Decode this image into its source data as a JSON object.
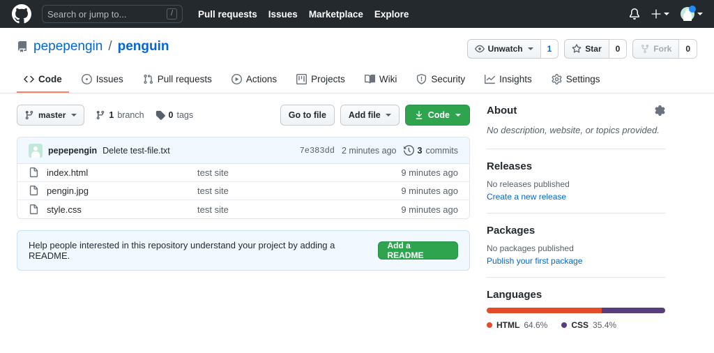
{
  "header": {
    "logo_icon": "github-mark-icon",
    "search": {
      "placeholder": "Search or jump to...",
      "value": "",
      "shortcut": "/"
    },
    "nav": [
      {
        "label": "Pull requests"
      },
      {
        "label": "Issues"
      },
      {
        "label": "Marketplace"
      },
      {
        "label": "Explore"
      }
    ],
    "notifications_icon": "bell-icon",
    "create_new_icon": "plus-icon",
    "avatar_icon": "user-avatar"
  },
  "repo": {
    "icon": "repo-icon",
    "owner": "pepepengin",
    "separator": "/",
    "name": "penguin",
    "actions": [
      {
        "name": "watch",
        "icon": "eye-icon",
        "label": "Unwatch",
        "count": "1",
        "has_caret": true,
        "muted": false
      },
      {
        "name": "star",
        "icon": "star-icon",
        "label": "Star",
        "count": "0",
        "has_caret": false,
        "muted": false
      },
      {
        "name": "fork",
        "icon": "fork-icon",
        "label": "Fork",
        "count": "0",
        "has_caret": false,
        "muted": true
      }
    ],
    "tabs": [
      {
        "label": "Code",
        "icon": "code-icon",
        "active": true
      },
      {
        "label": "Issues",
        "icon": "issue-opened-icon",
        "active": false
      },
      {
        "label": "Pull requests",
        "icon": "git-pull-request-icon",
        "active": false
      },
      {
        "label": "Actions",
        "icon": "play-icon",
        "active": false
      },
      {
        "label": "Projects",
        "icon": "project-board-icon",
        "active": false
      },
      {
        "label": "Wiki",
        "icon": "book-icon",
        "active": false
      },
      {
        "label": "Security",
        "icon": "shield-icon",
        "active": false
      },
      {
        "label": "Insights",
        "icon": "graph-icon",
        "active": false
      },
      {
        "label": "Settings",
        "icon": "gear-icon",
        "active": false
      }
    ]
  },
  "toolbar": {
    "branch_label": "master",
    "branch_icon": "git-branch-icon",
    "branches_count": "1",
    "branches_word": "branch",
    "tags_count": "0",
    "tags_word": "tags",
    "tag_icon": "tag-icon",
    "go_to_file_label": "Go to file",
    "add_file_label": "Add file",
    "code_label": "Code",
    "code_icon": "download-icon"
  },
  "commit": {
    "author": "pepepengin",
    "message": "Delete test-file.txt",
    "sha": "7e383dd",
    "time": "2 minutes ago",
    "commits_count": "3",
    "commits_word": "commits",
    "history_icon": "history-icon"
  },
  "files": {
    "icon": "file-icon",
    "rows": [
      {
        "name": "index.html",
        "message": "test site",
        "time": "9 minutes ago"
      },
      {
        "name": "pengin.jpg",
        "message": "test site",
        "time": "9 minutes ago"
      },
      {
        "name": "style.css",
        "message": "test site",
        "time": "9 minutes ago"
      }
    ]
  },
  "readme_banner": {
    "text": "Help people interested in this repository understand your project by adding a README.",
    "button_label": "Add a README"
  },
  "sidebar": {
    "about": {
      "title": "About",
      "gear_icon": "gear-icon",
      "description": "No description, website, or topics provided."
    },
    "releases": {
      "title": "Releases",
      "empty_text": "No releases published",
      "link_text": "Create a new release"
    },
    "packages": {
      "title": "Packages",
      "empty_text": "No packages published",
      "link_text": "Publish your first package"
    },
    "languages": {
      "title": "Languages",
      "items": [
        {
          "name": "HTML",
          "percent": "64.6%",
          "value": 64.6,
          "color": "#e34c26"
        },
        {
          "name": "CSS",
          "percent": "35.4%",
          "value": 35.4,
          "color": "#563d7c"
        }
      ]
    }
  },
  "colors": {
    "header_bg": "#24292e",
    "accent_link": "#0366d6",
    "green_button": "#2ea44f",
    "active_tab_underline": "#f9826c",
    "info_banner_bg": "#f1f8ff"
  }
}
